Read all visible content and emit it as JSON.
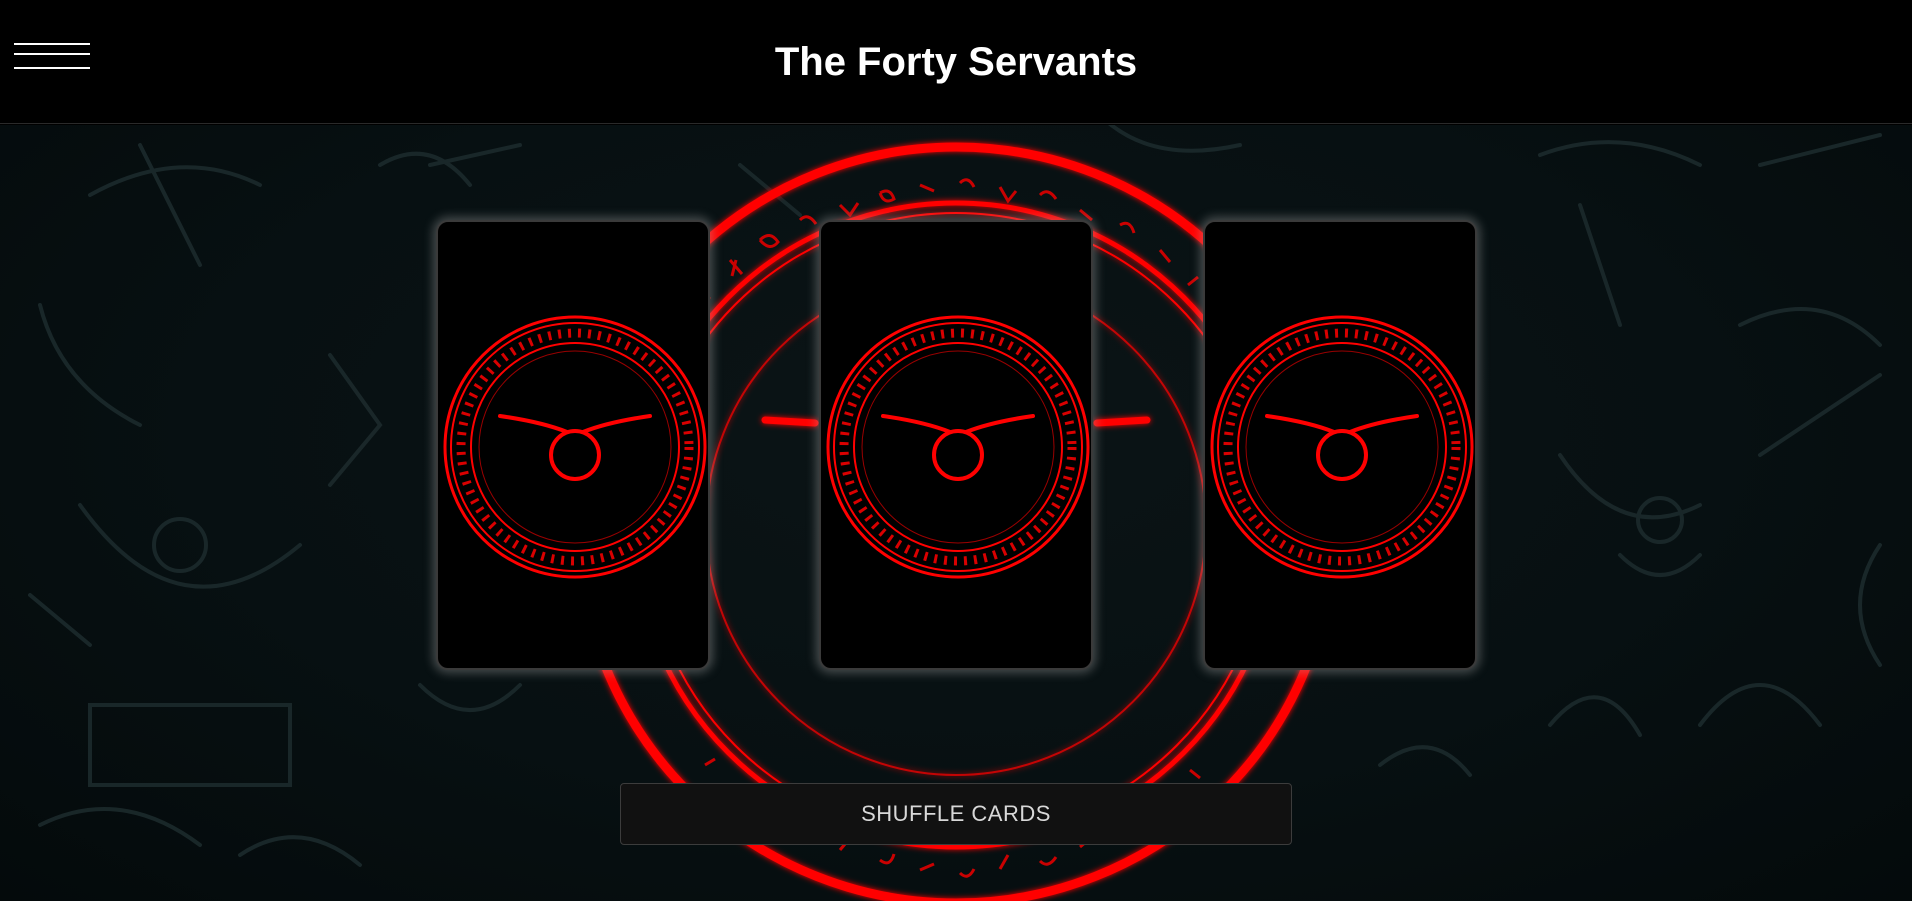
{
  "header": {
    "title": "The Forty Servants",
    "menu_icon": "hamburger-menu-icon"
  },
  "cards": [
    {
      "state": "face-down",
      "back_icon": "red-seal-sigil-icon"
    },
    {
      "state": "face-down",
      "back_icon": "red-seal-sigil-icon"
    },
    {
      "state": "face-down",
      "back_icon": "red-seal-sigil-icon"
    }
  ],
  "controls": {
    "shuffle_label": "SHUFFLE CARDS"
  },
  "colors": {
    "accent_red": "#ff0000",
    "header_bg": "#000000",
    "stage_bg": "#071012"
  }
}
